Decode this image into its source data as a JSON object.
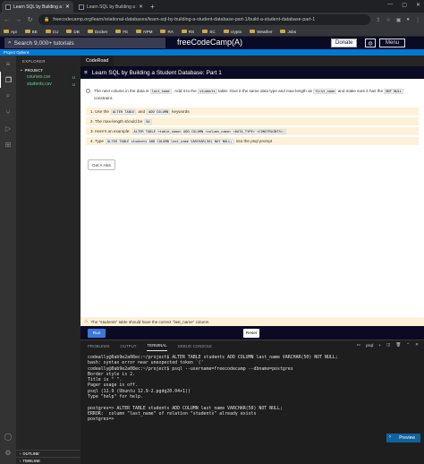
{
  "browser": {
    "tabs": [
      {
        "label": "Learn SQL by Building a Student Datab…",
        "active": true
      },
      {
        "label": "Learn SQL by Building a Student…",
        "active": false
      }
    ],
    "url": "freecodecamp.org/learn/relational-databases/learn-sql-by-building-a-student-database-part-1/build-a-student-database-part-1",
    "bookmarks": [
      "Api",
      "BE",
      "CU",
      "DB",
      "Docker",
      "FE",
      "NPM",
      "RA",
      "RS",
      "SC",
      "crypto",
      "Weather",
      "Jobs"
    ]
  },
  "fcc": {
    "search_placeholder": "Search 9,000+ tutorials",
    "brand": "freeCodeCamp(A)",
    "donate": "Donate",
    "menu": "Menu"
  },
  "project_options": "Project Options",
  "explorer": {
    "title": "EXPLORER",
    "project": "PROJECT",
    "files": [
      {
        "name": "courses.csv",
        "status": "U"
      },
      {
        "name": "students.csv",
        "status": "U"
      }
    ],
    "outline": "OUTLINE",
    "timeline": "TIMELINE"
  },
  "editor_tab": "CodeRoad",
  "tutorial": {
    "title": "Learn SQL by Building a Student Database: Part 1",
    "intro": {
      "t1": "The next column in the data is",
      "c1": "last_name",
      "t2": ". Add it to the",
      "c2": "students",
      "t3": "table. Give it the same data type and max-length as",
      "c3": "first_name",
      "t4": "and make sure it has the",
      "c4": "NOT NULL",
      "t5": "constraint."
    },
    "steps": [
      {
        "parts": [
          "1. Use the",
          "ALTER TABLE",
          "and",
          "ADD COLUMN",
          "keywords"
        ],
        "code": [
          false,
          true,
          false,
          true,
          false
        ]
      },
      {
        "parts": [
          "2. The max-length should be",
          "50"
        ],
        "code": [
          false,
          true
        ]
      },
      {
        "parts": [
          "3. Here's an example:",
          "ALTER TABLE <table_name> ADD COLUMN <column_name> <DATA_TYPE> <CONSTRAINTS>;"
        ],
        "code": [
          false,
          true
        ]
      },
      {
        "parts": [
          "4. Type",
          "ALTER TABLE students ADD COLUMN last_name VARCHAR(50) NOT NULL;",
          "into the psql prompt"
        ],
        "code": [
          false,
          true,
          false
        ]
      }
    ],
    "hint_button": "Get A Hint",
    "test_message": "The \"students\" table should have the correct \"last_name\" column",
    "run_button": "Run",
    "reset_button": "Reset"
  },
  "panel": {
    "tabs": [
      "PROBLEMS",
      "OUTPUT",
      "TERMINAL",
      "DEBUG CONSOLE"
    ],
    "active_tab": "TERMINAL",
    "terminal_name": "psql",
    "terminal_lines": [
      "codeally@0ab9e2a08ec:~/project$ ALTER TABLE students ADD COLUMN last_name VARCHAR(50) NOT NULL;",
      "bash: syntax error near unexpected token `('",
      "codeally@0ab9e2a08ec:~/project$ psql --username=freecodecamp --dbname=postgres",
      "Border style is 2.",
      "Title is \" \".",
      "Pager usage is off.",
      "psql (12.9 (Ubuntu 12.9-2.pgdg20.04+1))",
      "Type \"help\" for help.",
      "",
      "postgres=> ALTER TABLE students ADD COLUMN last_name VARCHAR(50) NOT NULL;",
      "ERROR:  column \"last_name\" of relation \"students\" already exists",
      "postgres=> "
    ],
    "preview_button": "Preview"
  }
}
